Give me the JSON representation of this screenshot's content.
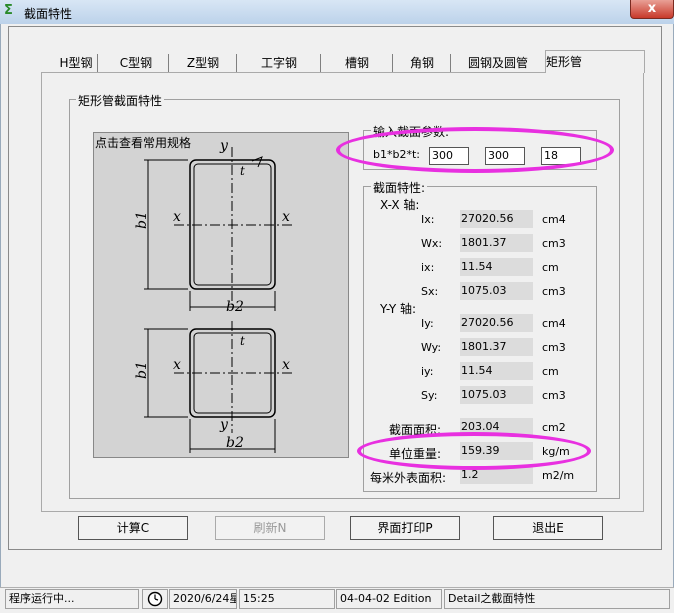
{
  "window": {
    "title": "截面特性",
    "close_glyph": "x"
  },
  "tabs": [
    "H型钢",
    "C型钢",
    "Z型钢",
    "工字钢",
    "槽钢",
    "角钢",
    "圆钢及圆管",
    "矩形管"
  ],
  "active_tab": "矩形管",
  "section_group_label": "矩形管截面特性",
  "drawing": {
    "caption": "点击查看常用规格",
    "labels": {
      "y": "y",
      "x": "x",
      "b1": "b1",
      "b2": "b2",
      "t": "t"
    }
  },
  "input": {
    "group_label": "输入截面参数:",
    "field_label": "b1*b2*t:",
    "b1": "300",
    "b2": "300",
    "t": "18"
  },
  "properties": {
    "group_label": "截面特性:",
    "xx_label": "X-X 轴:",
    "yy_label": "Y-Y 轴:",
    "xx": [
      {
        "name": "Ix:",
        "value": "27020.56",
        "unit": "cm4"
      },
      {
        "name": "Wx:",
        "value": "1801.37",
        "unit": "cm3"
      },
      {
        "name": "ix:",
        "value": "11.54",
        "unit": "cm"
      },
      {
        "name": "Sx:",
        "value": "1075.03",
        "unit": "cm3"
      }
    ],
    "yy": [
      {
        "name": "Iy:",
        "value": "27020.56",
        "unit": "cm4"
      },
      {
        "name": "Wy:",
        "value": "1801.37",
        "unit": "cm3"
      },
      {
        "name": "iy:",
        "value": "11.54",
        "unit": "cm"
      },
      {
        "name": "Sy:",
        "value": "1075.03",
        "unit": "cm3"
      }
    ],
    "area": {
      "name": "截面面积:",
      "value": "203.04",
      "unit": "cm2"
    },
    "weight": {
      "name": "单位重量:",
      "value": "159.39",
      "unit": "kg/m"
    },
    "surface": {
      "name": "每米外表面积:",
      "value": "1.2",
      "unit": "m2/m"
    }
  },
  "buttons": {
    "calc": "计算C",
    "refresh": "刷新N",
    "print": "界面打印P",
    "exit": "退出E"
  },
  "status": {
    "message": "程序运行中...",
    "date": "2020/6/24星",
    "time": "15:25",
    "edition": "04-04-02 Edition",
    "module": "Detail之截面特性"
  },
  "colors": {
    "highlight": "#e830e0",
    "value_bg": "#dcdcdc",
    "drawing_bg": "#d3d3d3"
  }
}
